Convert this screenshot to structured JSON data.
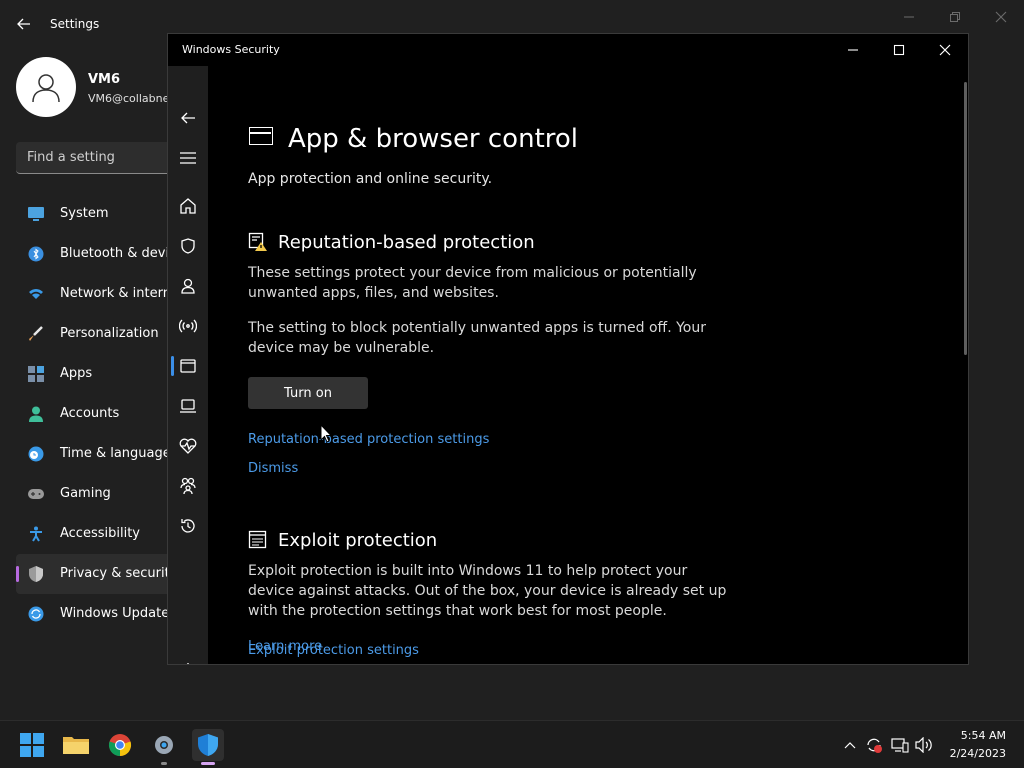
{
  "settings": {
    "title": "Settings",
    "user": {
      "name": "VM6",
      "email": "VM6@collabne"
    },
    "search_placeholder": "Find a setting",
    "nav": [
      {
        "label": "System",
        "icon": "monitor-icon",
        "color": "#4ca3e0"
      },
      {
        "label": "Bluetooth & devic",
        "icon": "bluetooth-icon",
        "color": "#3a8fe0"
      },
      {
        "label": "Network & intern",
        "icon": "wifi-icon",
        "color": "#3a9ae8"
      },
      {
        "label": "Personalization",
        "icon": "brush-icon",
        "color": "#e8a25a"
      },
      {
        "label": "Apps",
        "icon": "apps-icon",
        "color": "#7a8fa8"
      },
      {
        "label": "Accounts",
        "icon": "person-icon",
        "color": "#3fbf9a"
      },
      {
        "label": "Time & language",
        "icon": "clock-globe-icon",
        "color": "#3a9ae8"
      },
      {
        "label": "Gaming",
        "icon": "gamepad-icon",
        "color": "#9a9a9a"
      },
      {
        "label": "Accessibility",
        "icon": "accessibility-icon",
        "color": "#3a9ae8"
      },
      {
        "label": "Privacy & security",
        "icon": "shield-icon",
        "color": "#9a9a9a",
        "active": true
      },
      {
        "label": "Windows Update",
        "icon": "update-icon",
        "color": "#3a9ae8"
      }
    ]
  },
  "security": {
    "window_title": "Windows Security",
    "page_title": "App & browser control",
    "page_subtitle": "App protection and online security.",
    "reputation": {
      "title": "Reputation-based protection",
      "desc": "These settings protect your device from malicious or potentially unwanted apps, files, and websites.",
      "warning": "The setting to block potentially unwanted apps is turned off. Your device may be vulnerable.",
      "button": "Turn on",
      "settings_link": "Reputation-based protection settings",
      "dismiss_link": "Dismiss"
    },
    "exploit": {
      "title": "Exploit protection",
      "desc": "Exploit protection is built into Windows 11 to help protect your device against attacks.  Out of the box, your device is already set up with the protection settings that work best for most people.",
      "settings_link": "Exploit protection settings",
      "learn_more": "Learn more"
    },
    "rail": [
      "back-icon",
      "hamburger-icon",
      "home-icon",
      "shield-icon",
      "person-icon",
      "wifi-signal-icon",
      "app-browser-icon",
      "laptop-icon",
      "heart-pulse-icon",
      "family-icon",
      "history-icon",
      "gear-icon"
    ]
  },
  "taskbar": {
    "time": "5:54 AM",
    "date": "2/24/2023"
  },
  "colors": {
    "link": "#4c9be8",
    "accent_selection": "#3b8fe8",
    "settings_selection": "#b76ae0"
  }
}
